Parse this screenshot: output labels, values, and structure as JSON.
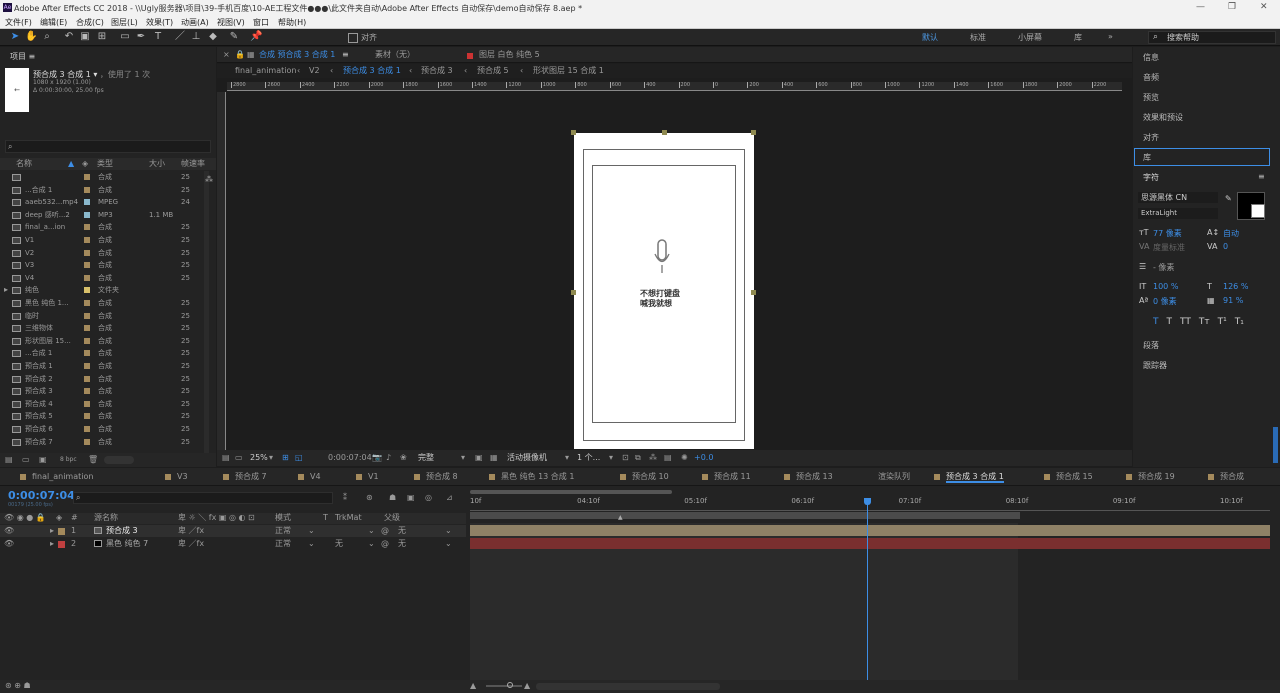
{
  "window": {
    "title": "Adobe After Effects CC 2018 - \\\\Ugly服务器\\项目\\39-手机百度\\10-AE工程文件●●●\\此文件夹自动\\Adobe After Effects 自动保存\\demo自动保存 8.aep *",
    "logo": "Ae"
  },
  "menu": [
    "文件(F)",
    "编辑(E)",
    "合成(C)",
    "图层(L)",
    "效果(T)",
    "动画(A)",
    "视图(V)",
    "窗口",
    "帮助(H)"
  ],
  "toolbar": {
    "snap_label": "对齐",
    "workspaces": [
      "默认",
      "标准",
      "小屏幕",
      "库"
    ],
    "search_placeholder": "搜索帮助"
  },
  "project": {
    "title": "项目",
    "comp_name": "预合成 3 合成 1",
    "comp_used": "，使用了 1 次",
    "comp_size": "1080 x 1920 (1.00)",
    "comp_duration": "Δ 0:00:30:00, 25.00 fps",
    "columns": [
      "名称",
      "类型",
      "大小",
      "帧速率"
    ],
    "items": [
      {
        "name": "",
        "type": "合成",
        "size": "",
        "fps": "25",
        "color": "#a48a5c"
      },
      {
        "name": "...合成 1",
        "type": "合成",
        "size": "",
        "fps": "25",
        "color": "#a48a5c"
      },
      {
        "name": "aaeb532...mp4",
        "type": "MPEG",
        "size": "",
        "fps": "24",
        "color": "#8ab8cc"
      },
      {
        "name": "deep 感听...2",
        "type": "MP3",
        "size": "1.1 MB",
        "fps": "",
        "color": "#8ab8cc"
      },
      {
        "name": "final_a...ion",
        "type": "合成",
        "size": "",
        "fps": "25",
        "color": "#a48a5c"
      },
      {
        "name": "V1",
        "type": "合成",
        "size": "",
        "fps": "25",
        "color": "#a48a5c"
      },
      {
        "name": "V2",
        "type": "合成",
        "size": "",
        "fps": "25",
        "color": "#a48a5c"
      },
      {
        "name": "V3",
        "type": "合成",
        "size": "",
        "fps": "25",
        "color": "#a48a5c"
      },
      {
        "name": "V4",
        "type": "合成",
        "size": "",
        "fps": "25",
        "color": "#a48a5c"
      },
      {
        "name": "纯色",
        "type": "文件夹",
        "size": "",
        "fps": "",
        "color": "#d8c06a"
      },
      {
        "name": "黑色 纯色 1...",
        "type": "合成",
        "size": "",
        "fps": "25",
        "color": "#a48a5c"
      },
      {
        "name": "临时",
        "type": "合成",
        "size": "",
        "fps": "25",
        "color": "#a48a5c"
      },
      {
        "name": "三维物体",
        "type": "合成",
        "size": "",
        "fps": "25",
        "color": "#a48a5c"
      },
      {
        "name": "形状图层 15...",
        "type": "合成",
        "size": "",
        "fps": "25",
        "color": "#a48a5c"
      },
      {
        "name": "...合成 1",
        "type": "合成",
        "size": "",
        "fps": "25",
        "color": "#a48a5c"
      },
      {
        "name": "预合成 1",
        "type": "合成",
        "size": "",
        "fps": "25",
        "color": "#a48a5c"
      },
      {
        "name": "预合成 2",
        "type": "合成",
        "size": "",
        "fps": "25",
        "color": "#a48a5c"
      },
      {
        "name": "预合成 3",
        "type": "合成",
        "size": "",
        "fps": "25",
        "color": "#a48a5c"
      },
      {
        "name": "预合成 4",
        "type": "合成",
        "size": "",
        "fps": "25",
        "color": "#a48a5c"
      },
      {
        "name": "预合成 5",
        "type": "合成",
        "size": "",
        "fps": "25",
        "color": "#a48a5c"
      },
      {
        "name": "预合成 6",
        "type": "合成",
        "size": "",
        "fps": "25",
        "color": "#a48a5c"
      },
      {
        "name": "预合成 7",
        "type": "合成",
        "size": "",
        "fps": "25",
        "color": "#a48a5c"
      }
    ],
    "bpc": "8 bpc"
  },
  "composition": {
    "tabs": [
      {
        "label": "合成 预合成 3 合成 1",
        "active": true
      },
      {
        "label": "素材（无）",
        "active": false
      },
      {
        "label": "图层 白色 纯色 5",
        "active": false
      }
    ],
    "breadcrumbs": [
      "final_animation",
      "V2",
      "预合成 3 合成 1",
      "预合成 3",
      "预合成 5",
      "形状图层 15 合成 1"
    ],
    "ruler": [
      "2800",
      "2600",
      "2400",
      "2200",
      "2000",
      "1800",
      "1600",
      "1400",
      "1200",
      "1000",
      "800",
      "600",
      "400",
      "200",
      "0",
      "200",
      "400",
      "600",
      "800",
      "1000",
      "1200",
      "1400",
      "1600",
      "1800",
      "2000",
      "2200"
    ],
    "canvas_text_line1": "不想打键盘",
    "canvas_text_line2": "喊我就想",
    "footer": {
      "zoom": "25%",
      "timecode": "0:00:07:04",
      "quality": "完整",
      "camera": "活动摄像机",
      "views": "1 个...",
      "exposure": "+0.0"
    }
  },
  "right": {
    "items": [
      "信息",
      "音频",
      "预览",
      "效果和预设",
      "对齐",
      "库"
    ],
    "char_title": "字符",
    "font": "思源黑体 CN",
    "style": "ExtraLight",
    "size": "77 像素",
    "leading": "自动",
    "kerning": "度量标准",
    "tracking": "0",
    "stroke": "- 像素",
    "vscale": "100 %",
    "hscale": "126 %",
    "baseline": "0 像素",
    "tsume": "91 %",
    "styles": [
      "T",
      "T",
      "TT",
      "Tт",
      "T¹",
      "T₁"
    ],
    "tail": [
      "段落",
      "跟踪器"
    ]
  },
  "timeline": {
    "tabs": [
      "final_animation",
      "V3",
      "预合成 7",
      "V4",
      "V1",
      "预合成 8",
      "黑色 纯色 13 合成 1",
      "预合成 10",
      "预合成 11",
      "预合成 13",
      "渲染队列",
      "预合成 3 合成 1",
      "预合成 15",
      "预合成 19",
      "预合成"
    ],
    "active_tab": "预合成 3 合成 1",
    "timecode": "0:00:07:04",
    "timecode_sub": "00179 (25.00 fps)",
    "columns": {
      "num": "#",
      "name": "源名称",
      "mode": "模式",
      "t": "T",
      "trkmat": "TrkMat",
      "parent": "父级"
    },
    "ruler": [
      "10f",
      "04:10f",
      "05:10f",
      "06:10f",
      "07:10f",
      "08:10f",
      "09:10f",
      "10:10f"
    ],
    "layers": [
      {
        "num": "1",
        "name": "预合成 3",
        "mode": "正常",
        "trkmat": "",
        "parent": "无",
        "color": "#a48a5c",
        "bar": "#8f8166"
      },
      {
        "num": "2",
        "name": "黑色 纯色 7",
        "mode": "正常",
        "trkmat": "无",
        "parent": "无",
        "color": "#c04040",
        "bar": "#7a2f2f"
      }
    ],
    "playhead_percent": 49.6
  }
}
